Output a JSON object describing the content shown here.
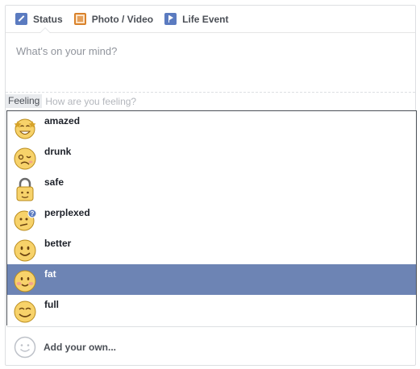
{
  "tabs": [
    {
      "label": "Status",
      "icon": "status-pencil-icon"
    },
    {
      "label": "Photo / Video",
      "icon": "photo-icon"
    },
    {
      "label": "Life Event",
      "icon": "life-event-flag-icon"
    }
  ],
  "composer": {
    "placeholder": "What's on your mind?"
  },
  "feeling": {
    "label": "Feeling",
    "placeholder": "How are you feeling?"
  },
  "feelings": [
    {
      "label": "amazed",
      "icon": "amazed-emoji-icon"
    },
    {
      "label": "drunk",
      "icon": "drunk-emoji-icon"
    },
    {
      "label": "safe",
      "icon": "safe-lock-emoji-icon"
    },
    {
      "label": "perplexed",
      "icon": "perplexed-emoji-icon"
    },
    {
      "label": "better",
      "icon": "better-emoji-icon"
    },
    {
      "label": "fat",
      "icon": "fat-emoji-icon"
    },
    {
      "label": "full",
      "icon": "full-emoji-icon"
    }
  ],
  "selected_feeling": "fat",
  "add_own": {
    "label": "Add your own...",
    "icon": "add-own-smiley-icon"
  },
  "colors": {
    "selection": "#6d84b4",
    "tab_accent": "#5b7bc0"
  }
}
